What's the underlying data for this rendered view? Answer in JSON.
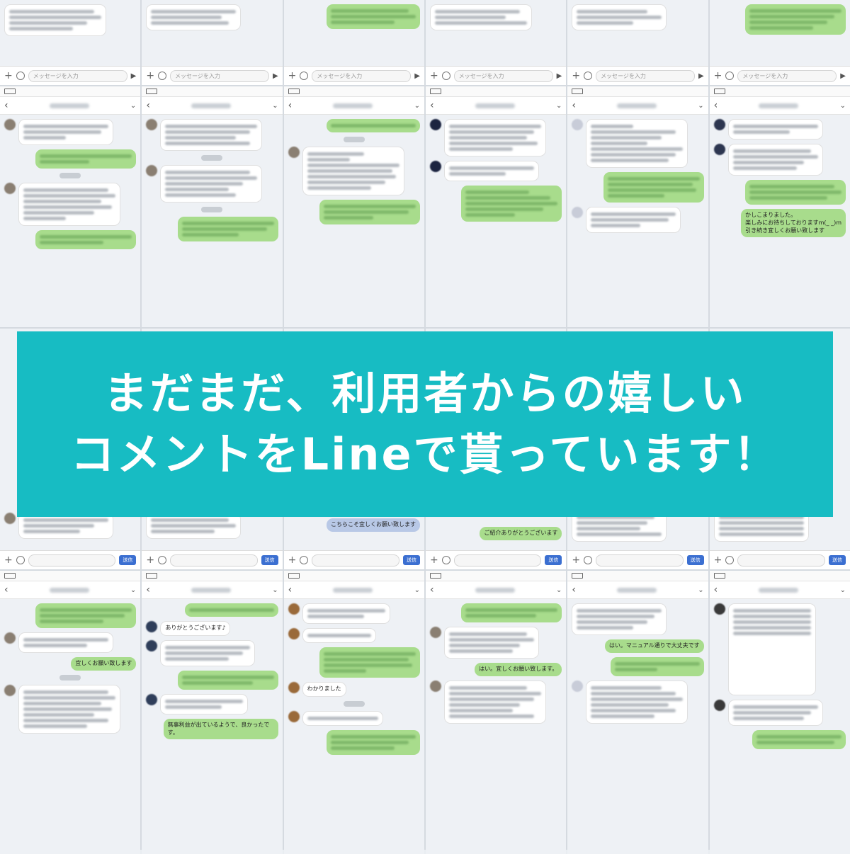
{
  "banner": {
    "line1": "まだまだ、利用者からの嬉しい",
    "line2": "コメントをLineで貰っています！"
  },
  "chat_ui": {
    "input_placeholder": "メッセージを入力",
    "send_label": "送信"
  },
  "visible_messages": [
    {
      "id": "m1",
      "direction": "out",
      "text": "かしこまりました。\n楽しみにお待ちしておりますm(_ _)m\n引き続き宜しくお願い致します"
    },
    {
      "id": "m2",
      "direction": "out",
      "text": "はい。マニュアル通りで大丈夫です"
    },
    {
      "id": "m3",
      "direction": "out",
      "text": "はい。宜しくお願い致します。"
    },
    {
      "id": "m4",
      "direction": "out",
      "text": "ご紹介ありがとうございます"
    },
    {
      "id": "m5",
      "direction": "out",
      "text": "こちらこそ宜しくお願い致します"
    },
    {
      "id": "m6",
      "direction": "out",
      "text": "無事利益が出ているようで、良かったです。"
    },
    {
      "id": "m7",
      "direction": "in",
      "text": "わかりました"
    },
    {
      "id": "m8",
      "direction": "in",
      "text": "ありがとうございます♪"
    },
    {
      "id": "m9",
      "direction": "out",
      "text": "宜しくお願い致します"
    }
  ],
  "colors": {
    "banner_bg": "#17bcc3",
    "banner_text": "#ffffff",
    "line_green_bubble": "#a8dc8c",
    "incoming_bubble": "#ffffff",
    "chat_background": "#eef1f5"
  }
}
